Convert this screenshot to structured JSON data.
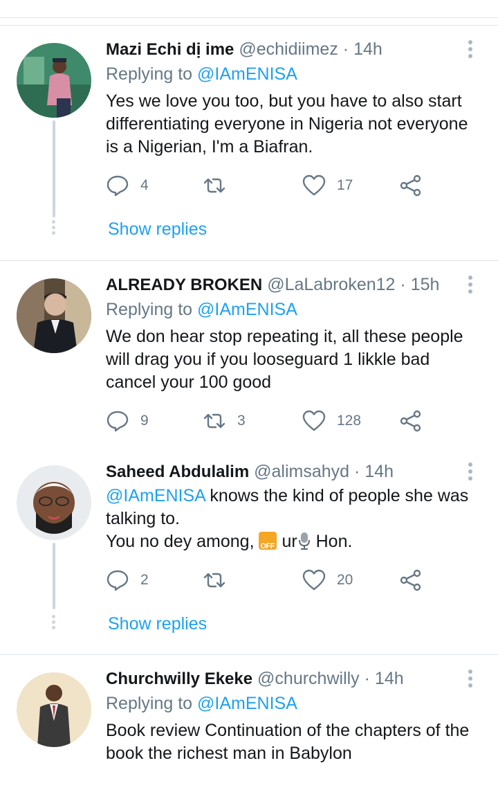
{
  "tweets": [
    {
      "name": "Mazi Echi dị ime",
      "handle": "@echidiimez",
      "time": "14h",
      "replying_prefix": "Replying to",
      "replying_to": "@IAmENISA",
      "text": "Yes we love you too, but you have to also start differentiating everyone in Nigeria not everyone is a Nigerian, I'm a Biafran.",
      "replies": "4",
      "retweets": "",
      "likes": "17",
      "show_replies": "Show replies",
      "avatar_icon": "person-avatar"
    },
    {
      "name": "ALREADY BROKEN",
      "handle": "@LaLabroken12",
      "time": "15h",
      "replying_prefix": "Replying to",
      "replying_to": "@IAmENISA",
      "text": "We don hear stop repeating it, all these people will drag you if you looseguard 1 likkle bad cancel your 100 good",
      "replies": "9",
      "retweets": "3",
      "likes": "128",
      "avatar_icon": "person-avatar"
    },
    {
      "name": "Saheed Abdulalim",
      "handle": "@alimsahyd",
      "time": "14h",
      "mention": "@IAmENISA",
      "text_after_mention": " knows the kind of people she was talking to.",
      "line2_a": "You no dey among,",
      "emoji_off": "OFF",
      "line2_b": "ur",
      "line2_c": "Hon.",
      "replies": "2",
      "retweets": "",
      "likes": "20",
      "show_replies": "Show replies",
      "avatar_icon": "person-avatar"
    },
    {
      "name": "Churchwilly Ekeke",
      "handle": "@churchwilly",
      "time": "14h",
      "replying_prefix": "Replying to",
      "replying_to": "@IAmENISA",
      "text": "Book review Continuation of the chapters of the book the richest man in Babylon",
      "avatar_icon": "person-avatar"
    }
  ],
  "separator": "·",
  "colors": {
    "accent": "#1da1f2",
    "muted": "#657786",
    "line": "#ccd6dd"
  }
}
